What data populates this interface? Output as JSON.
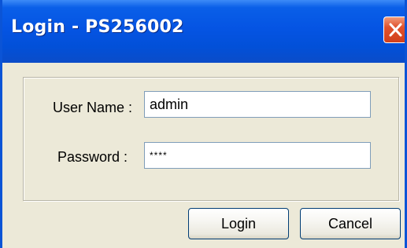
{
  "window": {
    "title": "Login - PS256002"
  },
  "form": {
    "username_label": "User Name :",
    "username_value": "admin",
    "password_label": "Password :",
    "password_value": "****"
  },
  "buttons": {
    "login_label": "Login",
    "cancel_label": "Cancel"
  },
  "icons": {
    "close": "close-icon"
  },
  "colors": {
    "titlebar": "#0554e3",
    "window_bg": "#ece9d8",
    "close_button": "#e0522d"
  }
}
